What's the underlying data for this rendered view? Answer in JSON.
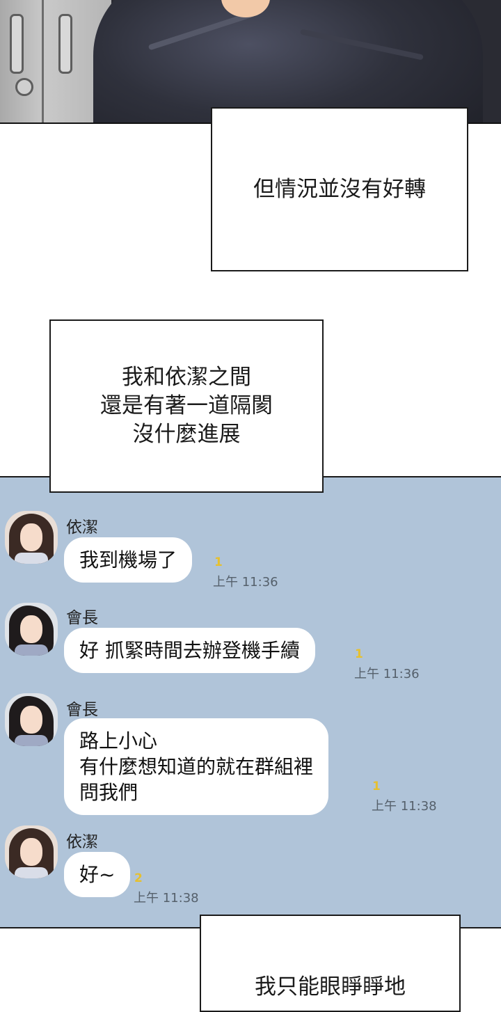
{
  "captions": [
    "但情況並沒有好轉",
    "我和依潔之間\n還是有著一道隔閡\n沒什麼進展",
    "我只能眼睜睜地"
  ],
  "chat": {
    "background_color": "#b0c4d9",
    "messages": [
      {
        "sender": "依潔",
        "text": "我到機場了",
        "read_count": "1",
        "time": "上午 11:36"
      },
      {
        "sender": "會長",
        "text": "好 抓緊時間去辦登機手續",
        "read_count": "1",
        "time": "上午 11:36"
      },
      {
        "sender": "會長",
        "text": "路上小心\n有什麼想知道的就在群組裡\n問我們",
        "read_count": "1",
        "time": "上午 11:38"
      },
      {
        "sender": "依潔",
        "text": "好~",
        "read_count": "2",
        "time": "上午 11:38"
      }
    ]
  }
}
